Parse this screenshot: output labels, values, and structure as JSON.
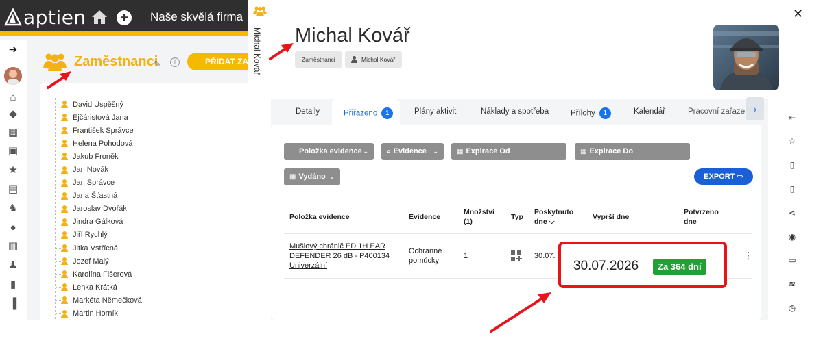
{
  "topbar": {
    "logo_text": "aptien",
    "company": "Naše skvělá firma"
  },
  "employees_section": {
    "title": "Zaměstnanci",
    "add_button_label": "PŘIDAT ZAM",
    "list": [
      "David Úspěšný",
      "Ejčáristová Jana",
      "František Správce",
      "Helena Pohodová",
      "Jakub Froněk",
      "Jan Novák",
      "Jan Správce",
      "Jana Šťastná",
      "Jaroslav Dvořák",
      "Jindra Gálková",
      "Jiří Rychlý",
      "Jitka Vstřícná",
      "Jozef Malý",
      "Karolína Fišerová",
      "Lenka Krátká",
      "Markéta Němečková",
      "Martin Horník"
    ]
  },
  "modal": {
    "side_label": "Michal Kovář",
    "name": "Michal Kovář",
    "breadcrumbs": [
      "Zaměstnanci",
      "Michal Kovář"
    ],
    "tabs": [
      {
        "label": "Detaily"
      },
      {
        "label": "Přiřazeno",
        "badge": "1",
        "active": true
      },
      {
        "label": "Plány aktivit"
      },
      {
        "label": "Náklady a spotřeba"
      },
      {
        "label": "Přílohy",
        "badge": "1"
      },
      {
        "label": "Kalendář"
      },
      {
        "label": "Pracovní zařaze"
      }
    ],
    "filters": {
      "item": "Položka evidence",
      "evidence": "Evidence",
      "expiry_from": "Expirace Od",
      "expiry_to": "Expirace Do",
      "issued": "Vydáno"
    },
    "export_label": "EXPORT",
    "table": {
      "headers": {
        "item": "Položka evidence",
        "evidence": "Evidence",
        "qty_1": "Množství",
        "qty_2": "(1)",
        "type": "Typ",
        "provided_1": "Poskytnuto",
        "provided_2": "dne",
        "expires": "Vyprší dne",
        "confirmed_1": "Potvrzeno",
        "confirmed_2": "dne"
      },
      "row": {
        "item_1": "Mušlový chránič ED 1H EAR",
        "item_2": "DEFENDER 26 dB - P400134",
        "item_3": "Univerzální",
        "evidence_1": "Ochranné",
        "evidence_2": "pomůcky",
        "qty": "1",
        "provided": "30.07.",
        "expires": "30.07.2026",
        "expires_in": "Za 364 dní"
      }
    }
  },
  "colors": {
    "brand_yellow": "#f6b900",
    "accent_blue": "#1a5fd6",
    "highlight_red": "#e8141c",
    "status_green": "#22a033"
  }
}
